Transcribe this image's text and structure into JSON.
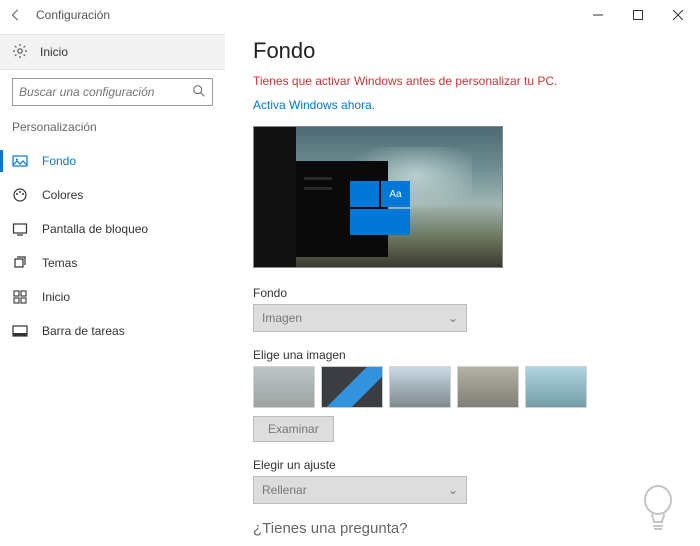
{
  "titlebar": {
    "title": "Configuración"
  },
  "sidebar": {
    "home": "Inicio",
    "search_placeholder": "Buscar una configuración",
    "category": "Personalización",
    "items": [
      {
        "label": "Fondo",
        "icon": "picture-icon"
      },
      {
        "label": "Colores",
        "icon": "palette-icon"
      },
      {
        "label": "Pantalla de bloqueo",
        "icon": "lockscreen-icon"
      },
      {
        "label": "Temas",
        "icon": "themes-icon"
      },
      {
        "label": "Inicio",
        "icon": "start-icon"
      },
      {
        "label": "Barra de tareas",
        "icon": "taskbar-icon"
      }
    ]
  },
  "main": {
    "heading": "Fondo",
    "activation_warning": "Tienes que activar Windows antes de personalizar tu PC.",
    "activate_link": "Activa Windows ahora.",
    "preview_sample_text": "Aa",
    "background_label": "Fondo",
    "background_value": "Imagen",
    "choose_image_label": "Elige una imagen",
    "browse_button": "Examinar",
    "fit_label": "Elegir un ajuste",
    "fit_value": "Rellenar",
    "question": "¿Tienes una pregunta?"
  }
}
